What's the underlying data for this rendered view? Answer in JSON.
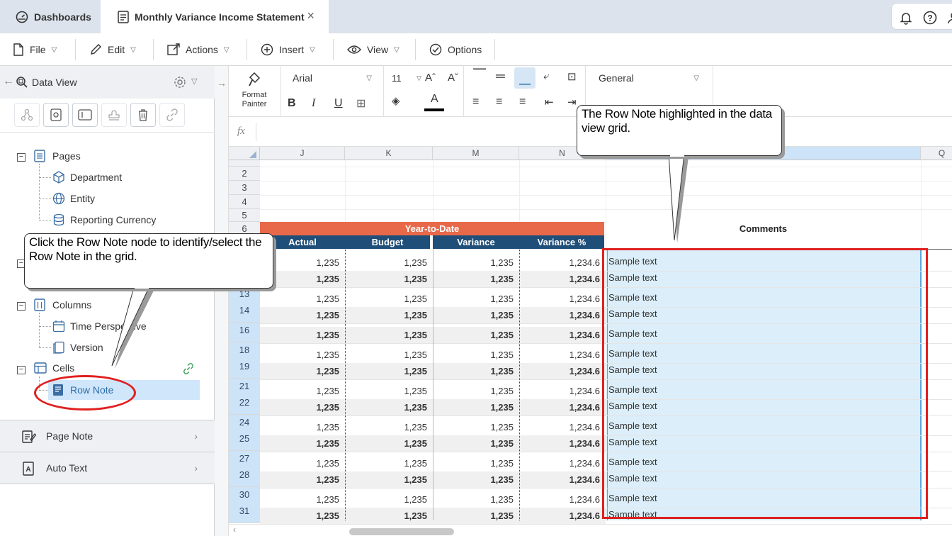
{
  "tabs": {
    "dashboards": "Dashboards",
    "report": "Monthly Variance Income Statement"
  },
  "menu": {
    "file": "File",
    "edit": "Edit",
    "actions": "Actions",
    "insert": "Insert",
    "view": "View",
    "options": "Options"
  },
  "sidebar": {
    "title": "Data View",
    "pages_label": "Pages",
    "pages_items": [
      "Department",
      "Entity",
      "Reporting Currency"
    ],
    "columns_label": "Columns",
    "columns_items": [
      "Time Perspective",
      "Version"
    ],
    "cells_label": "Cells",
    "cells_item": "Row Note",
    "page_note": "Page Note",
    "auto_text": "Auto Text"
  },
  "ribbon": {
    "format_painter": "Format Painter",
    "font": "Arial",
    "font_size": "11",
    "number_format": "General",
    "fx": "fx"
  },
  "grid": {
    "col_headers": [
      "J",
      "K",
      "M",
      "N",
      "",
      "Q"
    ],
    "row_headers_top": [
      "2",
      "3",
      "4",
      "5",
      "6"
    ],
    "banner": "Year-to-Date",
    "comments_header": "Comments",
    "headers": [
      "Actual",
      "Budget",
      "Variance",
      "Variance %"
    ],
    "data_rows": [
      {
        "num": "",
        "vals": [
          "1,235",
          "1,235",
          "1,235",
          "1,234.6"
        ],
        "bold": false
      },
      {
        "num": "",
        "vals": [
          "1,235",
          "1,235",
          "1,235",
          "1,234.6"
        ],
        "bold": true
      },
      {
        "num": "13",
        "vals": [
          "1,235",
          "1,235",
          "1,235",
          "1,234.6"
        ],
        "bold": false
      },
      {
        "num": "14",
        "vals": [
          "1,235",
          "1,235",
          "1,235",
          "1,234.6"
        ],
        "bold": true
      },
      {
        "num": "16",
        "vals": [
          "1,235",
          "1,235",
          "1,235",
          "1,234.6"
        ],
        "bold": true
      },
      {
        "num": "18",
        "vals": [
          "1,235",
          "1,235",
          "1,235",
          "1,234.6"
        ],
        "bold": false
      },
      {
        "num": "19",
        "vals": [
          "1,235",
          "1,235",
          "1,235",
          "1,234.6"
        ],
        "bold": true
      },
      {
        "num": "21",
        "vals": [
          "1,235",
          "1,235",
          "1,235",
          "1,234.6"
        ],
        "bold": false
      },
      {
        "num": "22",
        "vals": [
          "1,235",
          "1,235",
          "1,235",
          "1,234.6"
        ],
        "bold": true
      },
      {
        "num": "24",
        "vals": [
          "1,235",
          "1,235",
          "1,235",
          "1,234.6"
        ],
        "bold": false
      },
      {
        "num": "25",
        "vals": [
          "1,235",
          "1,235",
          "1,235",
          "1,234.6"
        ],
        "bold": true
      },
      {
        "num": "27",
        "vals": [
          "1,235",
          "1,235",
          "1,235",
          "1,234.6"
        ],
        "bold": false
      },
      {
        "num": "28",
        "vals": [
          "1,235",
          "1,235",
          "1,235",
          "1,234.6"
        ],
        "bold": true
      },
      {
        "num": "30",
        "vals": [
          "1,235",
          "1,235",
          "1,235",
          "1,234.6"
        ],
        "bold": false
      },
      {
        "num": "31",
        "vals": [
          "1,235",
          "1,235",
          "1,235",
          "1,234.6"
        ],
        "bold": true
      }
    ],
    "sample_text": "Sample text"
  },
  "callouts": {
    "left": "Click the Row Note node to identify/select the Row Note in the grid.",
    "right": "The Row Note highlighted in the data view grid."
  },
  "colors": {
    "banner": "#e8694a",
    "header": "#1f4e79",
    "highlight_border": "#e02020",
    "selection": "#dbeef9"
  }
}
